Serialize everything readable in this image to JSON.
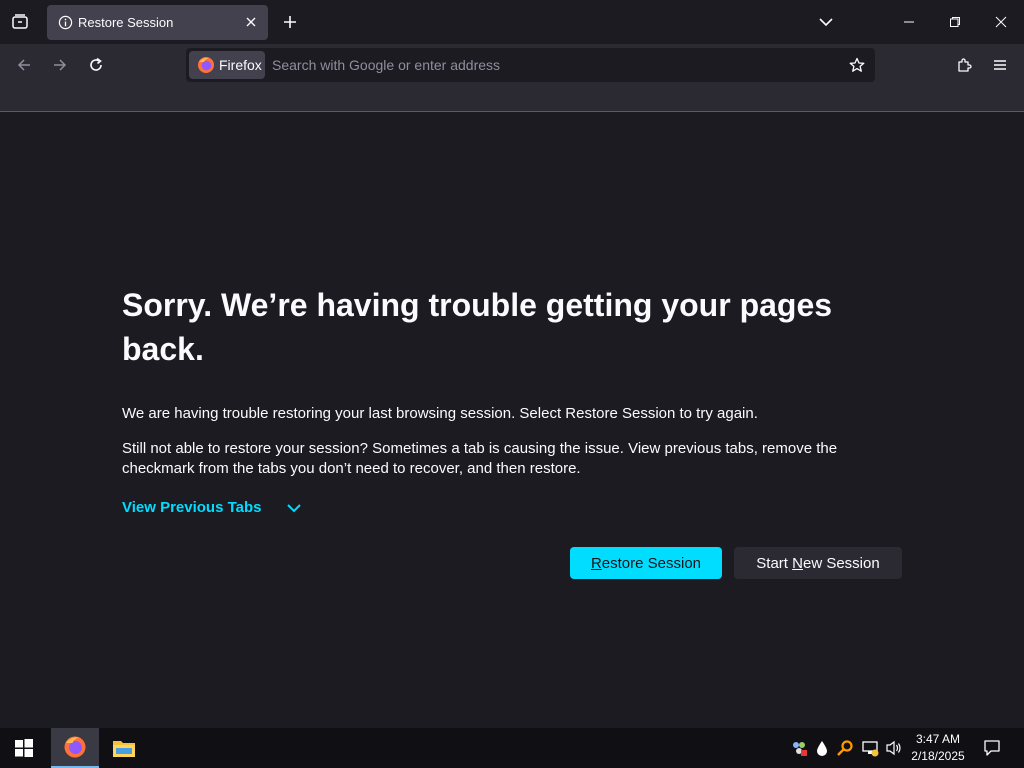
{
  "browser": {
    "tab": {
      "title": "Restore Session"
    },
    "identity_label": "Firefox",
    "url_placeholder": "Search with Google or enter address"
  },
  "page": {
    "heading": "Sorry. We’re having trouble getting your pages back.",
    "paragraph1": "We are having trouble restoring your last browsing session. Select Restore Session to try again.",
    "paragraph2": "Still not able to restore your session? Sometimes a tab is causing the issue. View previous tabs, remove the checkmark from the tabs you don’t need to recover, and then restore.",
    "view_previous_tabs": "View Previous Tabs",
    "restore_button": {
      "access": "R",
      "rest": "estore Session"
    },
    "new_session_button": {
      "pre": "Start ",
      "access": "N",
      "rest": "ew Session"
    }
  },
  "taskbar": {
    "time": "3:47 AM",
    "date": "2/18/2025"
  },
  "colors": {
    "accent": "#00ddff",
    "page_background": "#1c1b22",
    "toolbar": "#2b2a33",
    "selected_tab": "#42414d"
  },
  "icons": [
    "tab-list-icon",
    "info-icon",
    "close-icon",
    "plus-icon",
    "chevron-down-icon",
    "minimize-icon",
    "restore-icon",
    "window-close-icon",
    "back-icon",
    "forward-icon",
    "reload-icon",
    "firefox-icon",
    "star-icon",
    "extensions-icon",
    "menu-icon",
    "windows-start-icon",
    "firefox-taskbar-icon",
    "file-explorer-icon",
    "notification-icon"
  ]
}
